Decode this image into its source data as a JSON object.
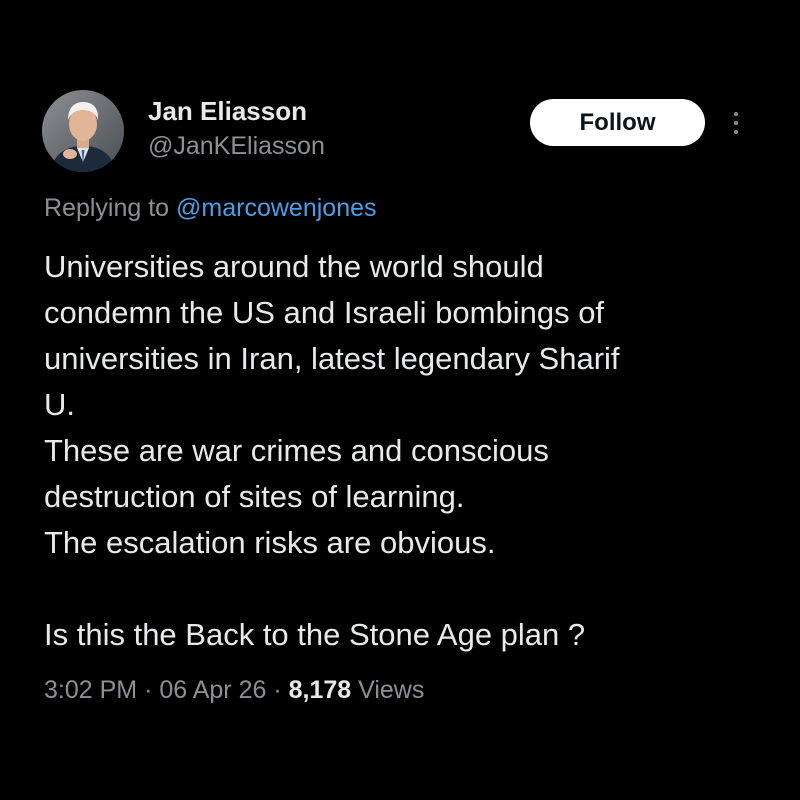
{
  "author": {
    "name": "Jan Eliasson",
    "handle": "@JanKEliasson"
  },
  "actions": {
    "follow_label": "Follow",
    "more_icon": "more-vertical-icon"
  },
  "reply": {
    "prefix": "Replying to",
    "to": "@marcowenjones"
  },
  "body": {
    "lines": [
      "Universities around the world should",
      "condemn the US and Israeli bombings of",
      "universities in Iran, latest legendary Sharif",
      "U.",
      "These are war crimes and conscious",
      "destruction of sites of learning.",
      "The escalation risks are obvious.",
      "",
      "Is this the Back to the Stone Age plan ?"
    ]
  },
  "meta": {
    "time": "3:02 PM",
    "separator": "·",
    "date": "06 Apr 26",
    "views_count": "8,178",
    "views_label": "Views"
  },
  "colors": {
    "background": "#000000",
    "text": "#e7e9ea",
    "secondary": "#8b9096",
    "link": "#4b9ee8",
    "button_bg": "#ffffff",
    "button_text": "#0f1419"
  }
}
